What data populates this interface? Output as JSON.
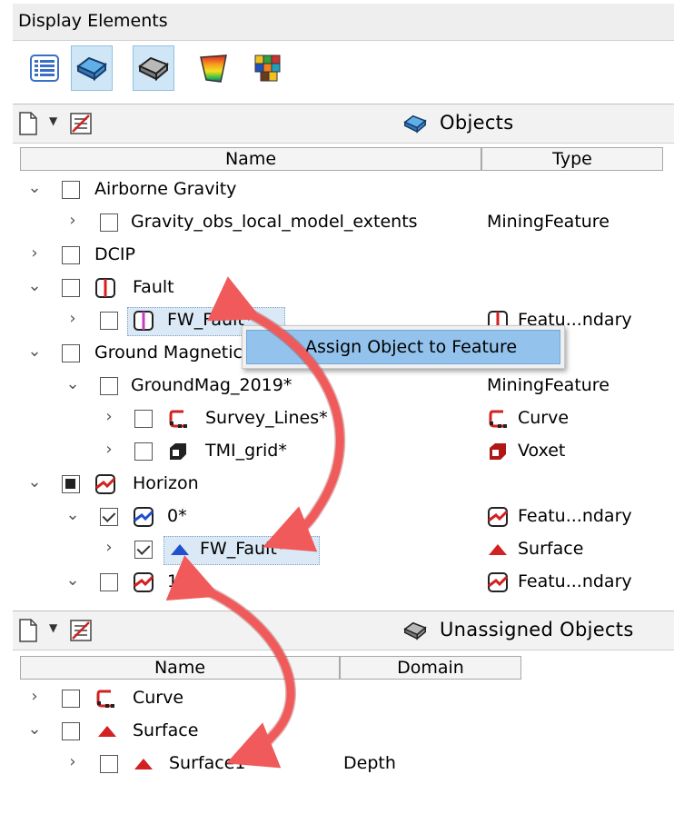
{
  "window": {
    "title": "Display Elements"
  },
  "toolbar": {
    "buttons": [
      "list-icon",
      "object-3d-icon",
      "object-grey-icon",
      "colormap-icon",
      "grid-icon"
    ]
  },
  "objects_panel": {
    "title": "Objects",
    "columns": {
      "name": "Name",
      "type": "Type"
    },
    "rows": [
      {
        "label": "Airborne Gravity",
        "type": ""
      },
      {
        "label": "Gravity_obs_local_model_extents",
        "type": "MiningFeature"
      },
      {
        "label": "DCIP",
        "type": ""
      },
      {
        "label": "Fault",
        "type": ""
      },
      {
        "label": "FW_Fault*",
        "type": "Featu...ndary"
      },
      {
        "label": "Ground Magnetic",
        "type": ""
      },
      {
        "label": "GroundMag_2019*",
        "type": "MiningFeature"
      },
      {
        "label": "Survey_Lines*",
        "type": "Curve"
      },
      {
        "label": "TMI_grid*",
        "type": "Voxet"
      },
      {
        "label": "Horizon",
        "type": ""
      },
      {
        "label": "0*",
        "type": "Featu...ndary"
      },
      {
        "label": "FW_Fault*",
        "type": "Surface"
      },
      {
        "label": "1*",
        "type": "Featu...ndary"
      }
    ]
  },
  "context_menu": {
    "item": "Assign Object to Feature"
  },
  "unassigned_panel": {
    "title": "Unassigned Objects",
    "columns": {
      "name": "Name",
      "domain": "Domain"
    },
    "rows": [
      {
        "label": "Curve",
        "domain": ""
      },
      {
        "label": "Surface",
        "domain": ""
      },
      {
        "label": "Surface1",
        "domain": "Depth"
      }
    ]
  },
  "colors": {
    "arrow": "#f05a5a",
    "selection": "#93c3ed",
    "fault_red": "#d32020",
    "surface_blue": "#2050d0"
  }
}
